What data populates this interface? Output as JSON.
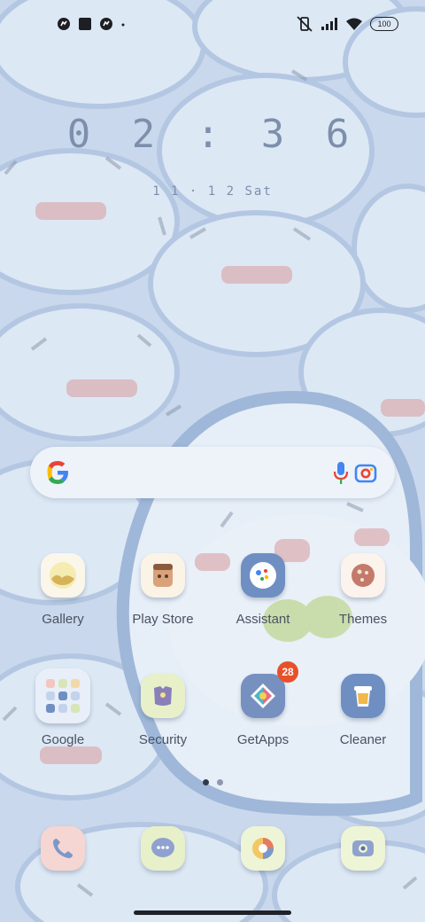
{
  "status_bar": {
    "left_icons": [
      "messenger-icon",
      "square-app-icon",
      "messenger-icon",
      "dot-icon"
    ],
    "right_icons": [
      "vibrate-off-icon",
      "signal-icon",
      "wifi-icon"
    ],
    "battery": "100"
  },
  "lock_clock": {
    "time": "0 2 : 3 6",
    "date": "1 1 · 1 2  Sat"
  },
  "search": {
    "icons": [
      "google-g-icon",
      "microphone-icon",
      "google-lens-icon"
    ]
  },
  "apps": [
    {
      "label": "Gallery",
      "icon": "gallery-icon",
      "color": "#fbf6ea"
    },
    {
      "label": "Play Store",
      "icon": "play-store-icon",
      "color": "#fbf3e6"
    },
    {
      "label": "Assistant",
      "icon": "assistant-icon",
      "color": "#6f8fc2"
    },
    {
      "label": "Themes",
      "icon": "themes-icon",
      "color": "#fbf3ec"
    },
    {
      "label": "Google",
      "icon": "google-folder-icon",
      "color": "#e8eff8"
    },
    {
      "label": "Security",
      "icon": "security-icon",
      "color": "#e7f0c9"
    },
    {
      "label": "GetApps",
      "icon": "getapps-icon",
      "color": "#7690c0",
      "badge": "28"
    },
    {
      "label": "Cleaner",
      "icon": "cleaner-icon",
      "color": "#6f8fc2"
    }
  ],
  "pager": {
    "pages": 2,
    "current": 1
  },
  "dock": [
    {
      "icon": "phone-icon",
      "color": "#f6d6d2"
    },
    {
      "icon": "messages-icon",
      "color": "#e7f0c9"
    },
    {
      "icon": "browser-icon",
      "color": "#eef4d6"
    },
    {
      "icon": "camera-icon",
      "color": "#eef4d6"
    }
  ]
}
